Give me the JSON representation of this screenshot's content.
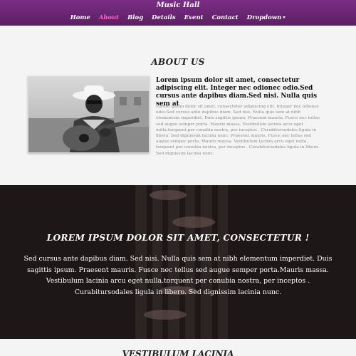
{
  "header": {
    "brand": "Music Hall",
    "nav": [
      {
        "label": "Home"
      },
      {
        "label": "About"
      },
      {
        "label": "Blog"
      },
      {
        "label": "Details"
      },
      {
        "label": "Event"
      },
      {
        "label": "Contact"
      },
      {
        "label": "Dropdown"
      }
    ]
  },
  "about": {
    "title": "ABOUT US",
    "lead": "Lorem ipsum dolor sit amet, consectetur adipiscing elit. Integer nec odionec odio.Sed cursus ante dapibus diam.Sed nisi. Nulla quis sem at",
    "body": "Lorem ipsum dolor sit amet, consectetur adipiscing elit. Integer nec odionec odio.Sed cursus ante dapibus diam. Sed nisi. Nulla quis sem at nibh elementum imperdiet. Duis sagittis ipsum. Praesent mauris. Fusce nec tellus sed augue semper porta. Mauris massa. Vestibulum lacinia arcu eget nulla.torquent per conubia nostra, per inceptos . Curabitursodales ligula in libero. Sed dignissim lacinia nunc. Praesent mauris. Fusce nec tellus sed augue semper porta. Mauris massa. Vestibulum lacinia arcu eget nulla. torquent per conubia nostra, per inceptos . Curabitursodales ligula in libero. Sed dignissim lacinia nunc."
  },
  "banner": {
    "title": "LOREM IPSUM DOLOR SIT AMET, CONSECTETUR !",
    "text": "Sed cursus ante dapibus diam. Sed nisi. Nulla quis sem at nibh elementum imperdiet. Duis sagittis ipsum. Praesent mauris. Fusce nec tellus sed augue semper porta.Mauris massa. Vestibulum lacinia arcu eget nulla.torquent per conubia nostra, per inceptos . Curabitursodales ligula in libero. Sed dignissim lacinia nunc."
  },
  "bottom": {
    "title": "VESTIBULUM LACINIA"
  },
  "colors": {
    "header": "#6a2573",
    "active_nav": "#ff63c8",
    "banner_bg": "#2a2424"
  }
}
